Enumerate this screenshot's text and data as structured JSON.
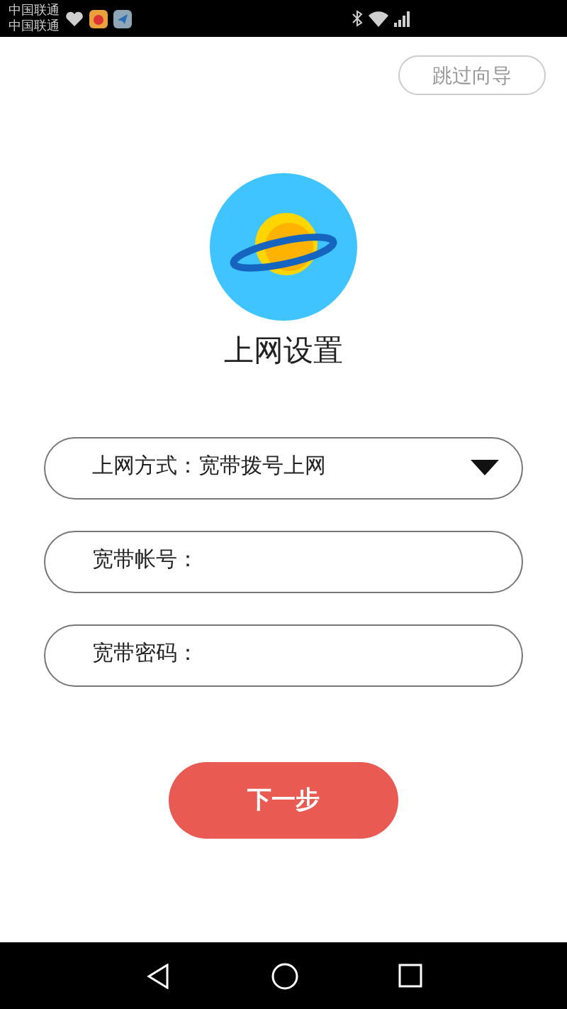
{
  "status_bar": {
    "carriers": [
      "中国联通",
      "中国联通"
    ]
  },
  "skip_button": "跳过向导",
  "title": "上网设置",
  "fields": [
    {
      "kind": "select",
      "label": "上网方式：",
      "value": "宽带拨号上网"
    },
    {
      "kind": "text",
      "label": "宽带帐号："
    },
    {
      "kind": "password",
      "label": "宽带密码："
    }
  ],
  "next_button": "下一步"
}
